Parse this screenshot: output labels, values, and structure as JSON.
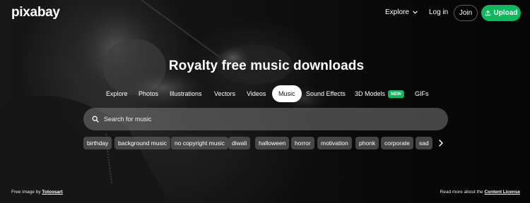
{
  "header": {
    "logo": "pixabay",
    "explore_label": "Explore",
    "login_label": "Log in",
    "join_label": "Join",
    "upload_label": "Upload"
  },
  "hero": {
    "headline": "Royalty free music downloads"
  },
  "tabs": [
    {
      "label": "Explore"
    },
    {
      "label": "Photos"
    },
    {
      "label": "Illustrations"
    },
    {
      "label": "Vectors"
    },
    {
      "label": "Videos"
    },
    {
      "label": "Music",
      "active": true
    },
    {
      "label": "Sound Effects"
    },
    {
      "label": "3D Models",
      "badge": "NEW"
    },
    {
      "label": "GIFs"
    }
  ],
  "search": {
    "placeholder": "Search for music"
  },
  "chips": [
    "birthday",
    "background music",
    "no copyright music",
    "diwali",
    "halloween",
    "horror",
    "motivation",
    "phonk",
    "corporate",
    "sad"
  ],
  "footer": {
    "credit_prefix": "Free image by",
    "credit_author": "Totoosart",
    "license_prefix": "Read more about the",
    "license_link": "Content License"
  },
  "colors": {
    "accent": "#0eb85e",
    "background": "#0d0d0d"
  },
  "icons": {
    "explore": "chevron-down-icon",
    "upload": "upload-icon",
    "search": "search-icon",
    "chips_next": "chevron-right-icon"
  }
}
